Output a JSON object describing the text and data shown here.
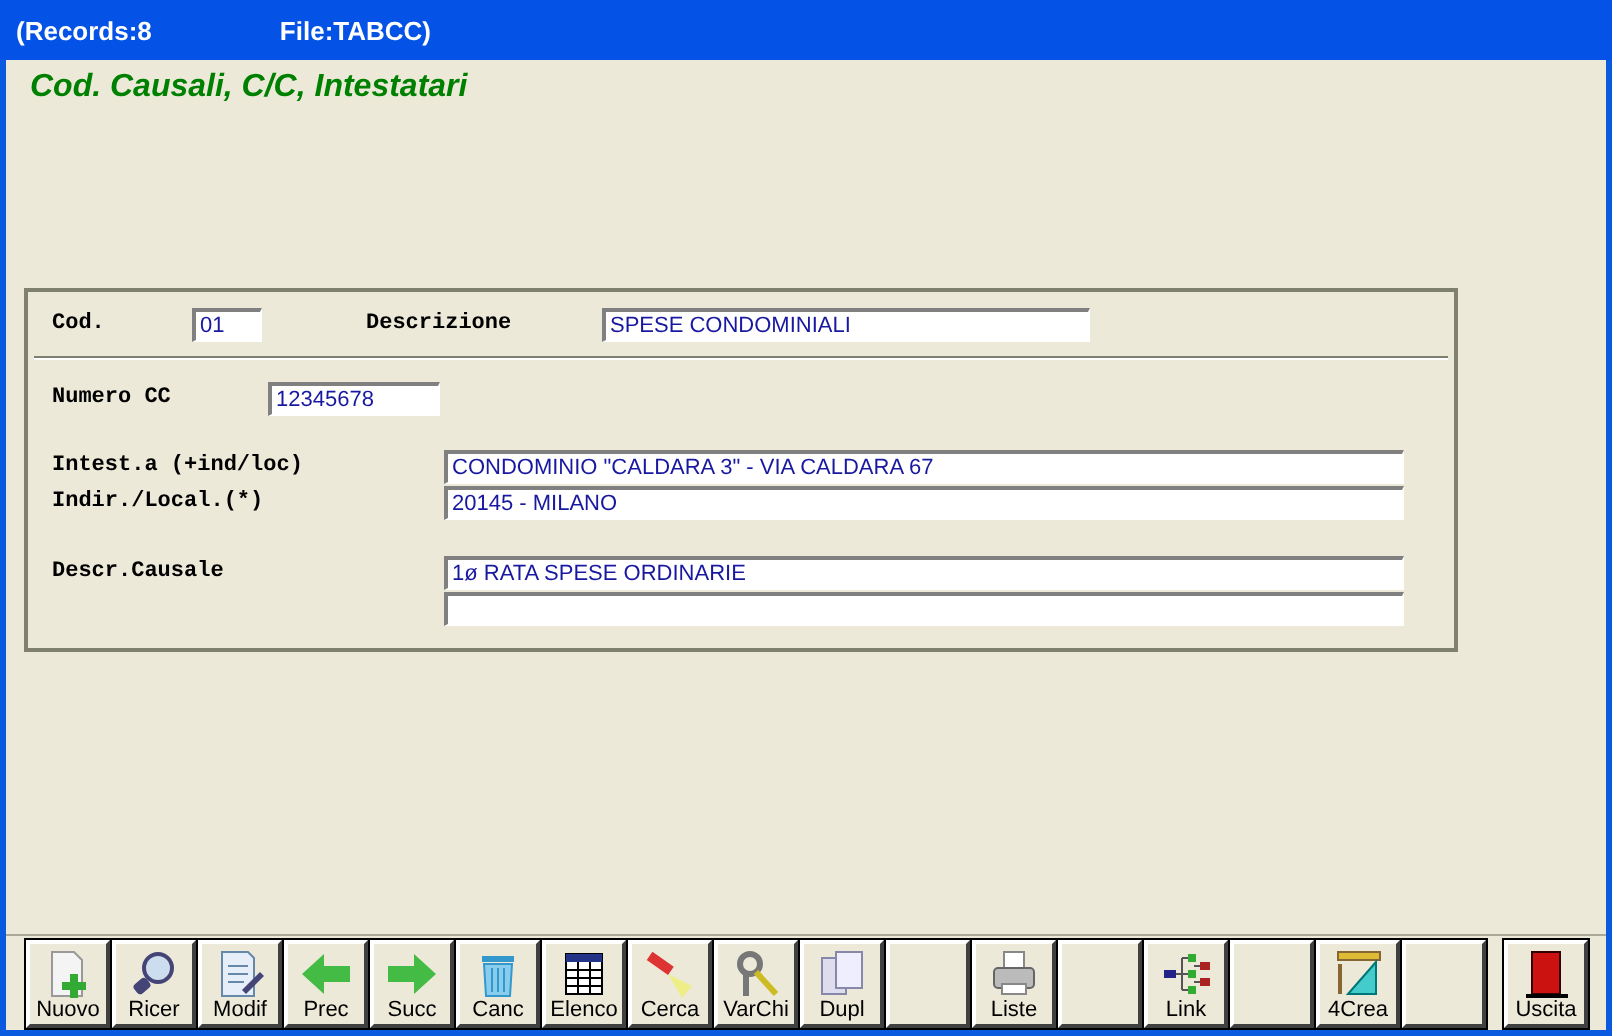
{
  "window": {
    "records": "(Records:8",
    "file": "File:TABCC)"
  },
  "heading": "Cod. Causali, C/C, Intestatari",
  "form": {
    "cod": {
      "label": "Cod.",
      "value": "01"
    },
    "descrizione": {
      "label": "Descrizione",
      "value": "SPESE CONDOMINIALI"
    },
    "numero_cc": {
      "label": "Numero CC",
      "value": "12345678"
    },
    "intestatario": {
      "label": "Intest.a (+ind/loc)",
      "value": "CONDOMINIO \"CALDARA 3\"  - VIA CALDARA 67"
    },
    "indirizzo": {
      "label": "Indir./Local.(*)",
      "value": "20145  - MILANO"
    },
    "descr_causale": {
      "label": "Descr.Causale",
      "value": "1ø RATA SPESE ORDINARIE"
    }
  },
  "toolbar": [
    {
      "kind": "new",
      "label": "Nuovo"
    },
    {
      "kind": "search",
      "label": "Ricer"
    },
    {
      "kind": "edit",
      "label": "Modif"
    },
    {
      "kind": "prev",
      "label": "Prec"
    },
    {
      "kind": "next",
      "label": "Succ"
    },
    {
      "kind": "delete",
      "label": "Canc"
    },
    {
      "kind": "list",
      "label": "Elenco"
    },
    {
      "kind": "find",
      "label": "Cerca"
    },
    {
      "kind": "keys",
      "label": "VarChi"
    },
    {
      "kind": "copy",
      "label": "Dupl"
    },
    {
      "kind": "empty"
    },
    {
      "kind": "print",
      "label": "Liste"
    },
    {
      "kind": "empty"
    },
    {
      "kind": "link",
      "label": "Link"
    },
    {
      "kind": "empty"
    },
    {
      "kind": "tools",
      "label": "4Crea"
    },
    {
      "kind": "empty"
    },
    {
      "kind": "exit",
      "label": "Uscita"
    }
  ]
}
